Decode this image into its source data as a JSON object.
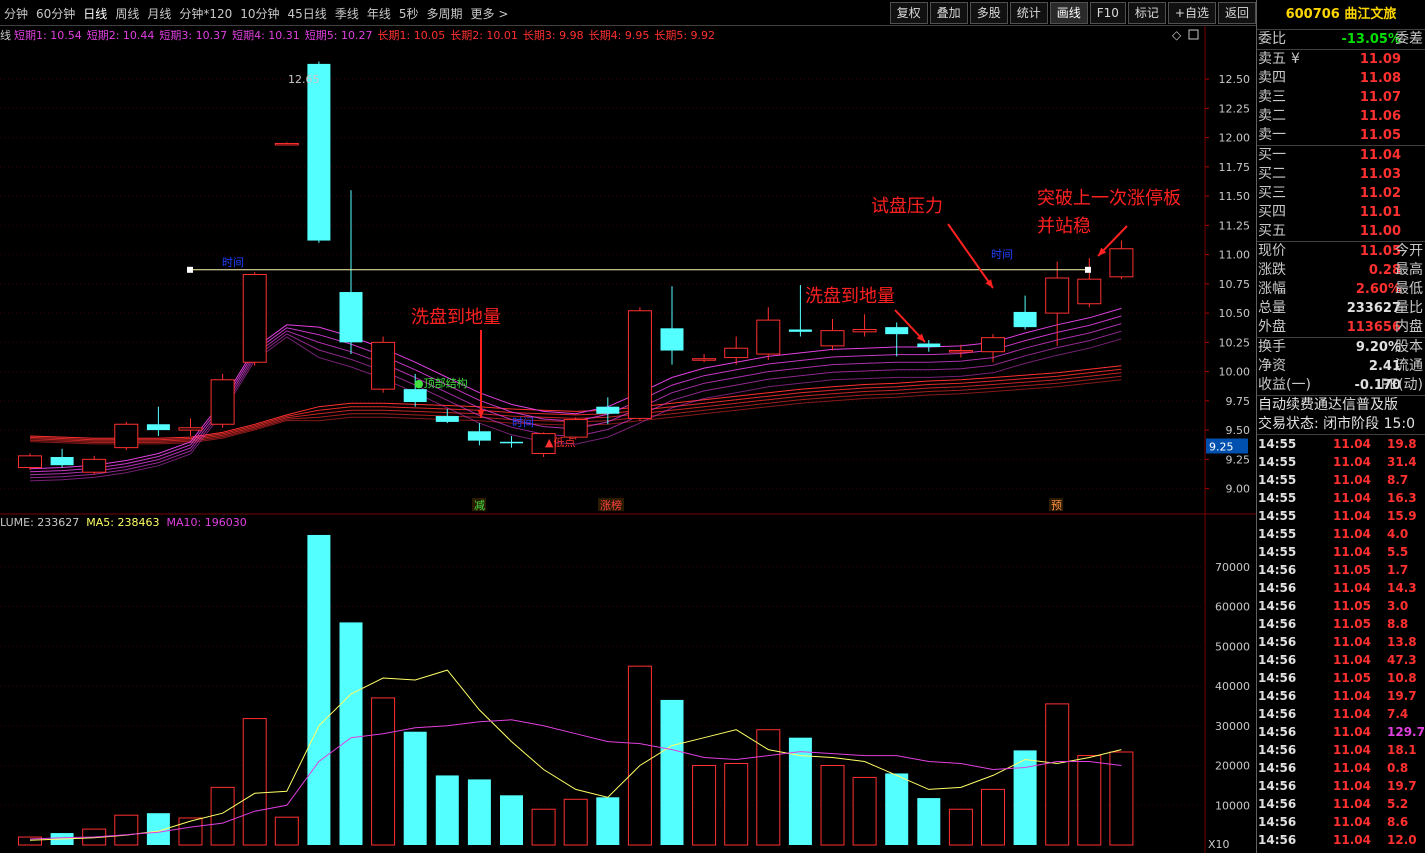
{
  "toolbar": {
    "periods": [
      "分钟",
      "60分钟",
      "日线",
      "周线",
      "月线",
      "分钟*120",
      "10分钟",
      "45日线",
      "季线",
      "年线",
      "5秒",
      "多周期",
      "更多 >"
    ],
    "active_period": "日线",
    "buttons": [
      "复权",
      "叠加",
      "多股",
      "统计",
      "画线",
      "F10",
      "标记",
      "+自选",
      "返回"
    ],
    "active_button": "画线"
  },
  "ma_legend": {
    "prefix": "线",
    "short": [
      "短期1: 10.54",
      "短期2: 10.44",
      "短期3: 10.37",
      "短期4: 10.31",
      "短期5: 10.27"
    ],
    "long": [
      "长期1: 10.05",
      "长期2: 10.01",
      "长期3: 9.98",
      "长期4: 9.95",
      "长期5: 9.92"
    ]
  },
  "volume_legend": {
    "volume": "LUME: 233627",
    "ma5": "MA5: 238463",
    "ma10": "MA10: 196030"
  },
  "annotations": {
    "peak_label": "12.65",
    "marker_time_1": "时间",
    "marker_time_2": "时间",
    "marker_time_3": "时间",
    "top_structure": "●顶部结构",
    "low_point": "▲低点",
    "wash_1": "洗盘到地量",
    "wash_2": "洗盘到地量",
    "test_pressure": "试盘压力",
    "breakout_line1": "突破上一次涨停板",
    "breakout_line2": "并站稳",
    "event_reduce": "减",
    "event_limit_list": "涨榜",
    "event_forecast": "预",
    "current_price_tag": "9.25",
    "volume_scale": "X10"
  },
  "price_axis": [
    "12.50",
    "12.25",
    "12.00",
    "11.75",
    "11.50",
    "11.25",
    "11.00",
    "10.75",
    "10.50",
    "10.25",
    "10.00",
    "9.75",
    "9.50",
    "9.25",
    "9.00"
  ],
  "volume_axis": [
    "70000",
    "60000",
    "50000",
    "40000",
    "30000",
    "20000",
    "10000"
  ],
  "colors": {
    "up": "#ff3030",
    "down": "#54ffff",
    "short_ma": "#e040e0",
    "long_ma": "#ff3030",
    "ma5": "#ffff66",
    "ma10": "#e040e0",
    "annotation": "#ff2020",
    "marker": "#2040ff"
  },
  "chart_data": {
    "type": "candlestick",
    "price_range": [
      8.8,
      12.8
    ],
    "volume_range": [
      0,
      80000
    ],
    "candles": [
      {
        "o": 9.18,
        "c": 9.28,
        "h": 9.3,
        "l": 9.16,
        "v": 2000
      },
      {
        "o": 9.27,
        "c": 9.2,
        "h": 9.34,
        "l": 9.18,
        "v": 3000
      },
      {
        "o": 9.14,
        "c": 9.25,
        "h": 9.28,
        "l": 9.12,
        "v": 4000
      },
      {
        "o": 9.35,
        "c": 9.55,
        "h": 9.57,
        "l": 9.33,
        "v": 7500
      },
      {
        "o": 9.55,
        "c": 9.5,
        "h": 9.7,
        "l": 9.45,
        "v": 8000
      },
      {
        "o": 9.5,
        "c": 9.52,
        "h": 9.6,
        "l": 9.45,
        "v": 6800
      },
      {
        "o": 9.55,
        "c": 9.93,
        "h": 9.98,
        "l": 9.52,
        "v": 14500
      },
      {
        "o": 10.08,
        "c": 10.83,
        "h": 10.85,
        "l": 10.05,
        "v": 31800
      },
      {
        "o": 11.95,
        "c": 11.95,
        "h": 11.96,
        "l": 11.94,
        "v": 7000
      },
      {
        "o": 12.63,
        "c": 11.12,
        "h": 12.65,
        "l": 11.1,
        "v": 78000
      },
      {
        "o": 10.68,
        "c": 10.25,
        "h": 11.55,
        "l": 10.15,
        "v": 56000
      },
      {
        "o": 9.85,
        "c": 10.25,
        "h": 10.3,
        "l": 9.82,
        "v": 37000
      },
      {
        "o": 9.85,
        "c": 9.74,
        "h": 9.98,
        "l": 9.7,
        "v": 28500
      },
      {
        "o": 9.62,
        "c": 9.57,
        "h": 9.68,
        "l": 9.56,
        "v": 17500
      },
      {
        "o": 9.49,
        "c": 9.41,
        "h": 9.56,
        "l": 9.37,
        "v": 16500
      },
      {
        "o": 9.4,
        "c": 9.39,
        "h": 9.45,
        "l": 9.35,
        "v": 12500
      },
      {
        "o": 9.3,
        "c": 9.47,
        "h": 9.48,
        "l": 9.27,
        "v": 9000
      },
      {
        "o": 9.44,
        "c": 9.59,
        "h": 9.61,
        "l": 9.42,
        "v": 11500
      },
      {
        "o": 9.7,
        "c": 9.64,
        "h": 9.78,
        "l": 9.55,
        "v": 12000
      },
      {
        "o": 9.6,
        "c": 10.52,
        "h": 10.55,
        "l": 9.58,
        "v": 45000
      },
      {
        "o": 10.37,
        "c": 10.18,
        "h": 10.73,
        "l": 10.06,
        "v": 36500
      },
      {
        "o": 10.1,
        "c": 10.11,
        "h": 10.15,
        "l": 10.08,
        "v": 20000
      },
      {
        "o": 10.12,
        "c": 10.2,
        "h": 10.3,
        "l": 10.06,
        "v": 20500
      },
      {
        "o": 10.15,
        "c": 10.44,
        "h": 10.55,
        "l": 10.1,
        "v": 29000
      },
      {
        "o": 10.36,
        "c": 10.34,
        "h": 10.74,
        "l": 10.3,
        "v": 27000
      },
      {
        "o": 10.22,
        "c": 10.35,
        "h": 10.45,
        "l": 10.18,
        "v": 20000
      },
      {
        "o": 10.34,
        "c": 10.36,
        "h": 10.49,
        "l": 10.3,
        "v": 17000
      },
      {
        "o": 10.38,
        "c": 10.32,
        "h": 10.42,
        "l": 10.13,
        "v": 18000
      },
      {
        "o": 10.24,
        "c": 10.21,
        "h": 10.27,
        "l": 10.17,
        "v": 11800
      },
      {
        "o": 10.18,
        "c": 10.18,
        "h": 10.23,
        "l": 10.12,
        "v": 9000
      },
      {
        "o": 10.17,
        "c": 10.29,
        "h": 10.32,
        "l": 10.08,
        "v": 14000
      },
      {
        "o": 10.51,
        "c": 10.38,
        "h": 10.65,
        "l": 10.36,
        "v": 23800
      },
      {
        "o": 10.5,
        "c": 10.8,
        "h": 10.94,
        "l": 10.22,
        "v": 35500
      },
      {
        "o": 10.58,
        "c": 10.79,
        "h": 10.97,
        "l": 10.55,
        "v": 22500
      },
      {
        "o": 10.81,
        "c": 11.05,
        "h": 11.12,
        "l": 10.79,
        "v": 23400
      }
    ],
    "ma5_volume": [
      1200,
      1500,
      1800,
      2500,
      3500,
      6000,
      8000,
      13000,
      13500,
      30000,
      38000,
      42000,
      41500,
      44000,
      34000,
      26000,
      19000,
      14000,
      12000,
      20000,
      25000,
      27000,
      29000,
      24000,
      22500,
      22000,
      21000,
      17500,
      14000,
      14500,
      17500,
      21500,
      20500,
      22000,
      24000
    ],
    "ma10_volume": [
      1500,
      1800,
      2000,
      2600,
      3200,
      4500,
      5500,
      8500,
      10000,
      21000,
      27000,
      28000,
      29500,
      30000,
      31000,
      31500,
      30000,
      28000,
      26000,
      25500,
      24000,
      22000,
      21500,
      22500,
      23500,
      23000,
      22500,
      22500,
      21000,
      20500,
      19000,
      19500,
      21000,
      21000,
      20000
    ],
    "short_ma": [
      9.17,
      9.18,
      9.2,
      9.24,
      9.3,
      9.4,
      9.75,
      10.2,
      10.4,
      10.38,
      10.3,
      10.2,
      10.08,
      9.95,
      9.82,
      9.72,
      9.66,
      9.64,
      9.7,
      9.82,
      9.95,
      10.03,
      10.08,
      10.13,
      10.16,
      10.19,
      10.2,
      10.21,
      10.21,
      10.22,
      10.25,
      10.33,
      10.4,
      10.46,
      10.54
    ],
    "long_ma": [
      9.45,
      9.44,
      9.43,
      9.43,
      9.43,
      9.44,
      9.48,
      9.55,
      9.63,
      9.7,
      9.73,
      9.73,
      9.72,
      9.71,
      9.7,
      9.68,
      9.67,
      9.66,
      9.67,
      9.7,
      9.73,
      9.76,
      9.79,
      9.82,
      9.85,
      9.87,
      9.89,
      9.9,
      9.92,
      9.93,
      9.95,
      9.97,
      9.99,
      10.02,
      10.05
    ]
  },
  "quote": {
    "code": "600706",
    "name": "曲江文旅",
    "weibi_label": "委比",
    "weibi_value": "-13.05%",
    "weicha_label": "委差",
    "asks": [
      {
        "label": "卖五",
        "mark": "¥",
        "price": "11.09"
      },
      {
        "label": "卖四",
        "mark": "",
        "price": "11.08"
      },
      {
        "label": "卖三",
        "mark": "",
        "price": "11.07"
      },
      {
        "label": "卖二",
        "mark": "",
        "price": "11.06"
      },
      {
        "label": "卖一",
        "mark": "",
        "price": "11.05"
      }
    ],
    "bids": [
      {
        "label": "买一",
        "price": "11.04"
      },
      {
        "label": "买二",
        "price": "11.03"
      },
      {
        "label": "买三",
        "price": "11.02"
      },
      {
        "label": "买四",
        "price": "11.01"
      },
      {
        "label": "买五",
        "price": "11.00"
      }
    ],
    "stats": [
      {
        "label": "现价",
        "value": "11.05",
        "right": "今开",
        "color": "red"
      },
      {
        "label": "涨跌",
        "value": "0.28",
        "right": "最高",
        "color": "red"
      },
      {
        "label": "涨幅",
        "value": "2.60%",
        "right": "最低",
        "color": "red"
      },
      {
        "label": "总量",
        "value": "233627",
        "right": "量比",
        "color": "white"
      },
      {
        "label": "外盘",
        "value": "113656",
        "right": "内盘",
        "color": "red"
      }
    ],
    "stats2": [
      {
        "label": "换手",
        "value": "9.20%",
        "right": "股本",
        "color": "white"
      },
      {
        "label": "净资",
        "value": "2.41",
        "right": "流通",
        "color": "white"
      },
      {
        "label": "收益(一)",
        "value": "-0.170",
        "right": "PE(动)",
        "color": "white"
      }
    ],
    "info_line1": "自动续费通达信普及版",
    "info_line2": "交易状态: 闭市阶段 15:0",
    "ticks": [
      {
        "time": "14:55",
        "price": "11.04",
        "vol": "19.8",
        "pc": "red",
        "vc": "red"
      },
      {
        "time": "14:55",
        "price": "11.04",
        "vol": "31.4",
        "pc": "red",
        "vc": "red"
      },
      {
        "time": "14:55",
        "price": "11.04",
        "vol": "8.7",
        "pc": "red",
        "vc": "red"
      },
      {
        "time": "14:55",
        "price": "11.04",
        "vol": "16.3",
        "pc": "red",
        "vc": "red"
      },
      {
        "time": "14:55",
        "price": "11.04",
        "vol": "15.9",
        "pc": "red",
        "vc": "red"
      },
      {
        "time": "14:55",
        "price": "11.04",
        "vol": "4.0",
        "pc": "red",
        "vc": "red"
      },
      {
        "time": "14:55",
        "price": "11.04",
        "vol": "5.5",
        "pc": "red",
        "vc": "red"
      },
      {
        "time": "14:56",
        "price": "11.05",
        "vol": "1.7",
        "pc": "red",
        "vc": "red"
      },
      {
        "time": "14:56",
        "price": "11.04",
        "vol": "14.3",
        "pc": "red",
        "vc": "red"
      },
      {
        "time": "14:56",
        "price": "11.05",
        "vol": "3.0",
        "pc": "red",
        "vc": "red"
      },
      {
        "time": "14:56",
        "price": "11.05",
        "vol": "8.8",
        "pc": "red",
        "vc": "red"
      },
      {
        "time": "14:56",
        "price": "11.04",
        "vol": "13.8",
        "pc": "red",
        "vc": "red"
      },
      {
        "time": "14:56",
        "price": "11.04",
        "vol": "47.3",
        "pc": "red",
        "vc": "red"
      },
      {
        "time": "14:56",
        "price": "11.05",
        "vol": "10.8",
        "pc": "red",
        "vc": "red"
      },
      {
        "time": "14:56",
        "price": "11.04",
        "vol": "19.7",
        "pc": "red",
        "vc": "red"
      },
      {
        "time": "14:56",
        "price": "11.04",
        "vol": "7.4",
        "pc": "red",
        "vc": "red"
      },
      {
        "time": "14:56",
        "price": "11.04",
        "vol": "129.7",
        "pc": "red",
        "vc": "magenta"
      },
      {
        "time": "14:56",
        "price": "11.04",
        "vol": "18.1",
        "pc": "red",
        "vc": "red"
      },
      {
        "time": "14:56",
        "price": "11.04",
        "vol": "0.8",
        "pc": "red",
        "vc": "red"
      },
      {
        "time": "14:56",
        "price": "11.04",
        "vol": "19.7",
        "pc": "red",
        "vc": "red"
      },
      {
        "time": "14:56",
        "price": "11.04",
        "vol": "5.2",
        "pc": "red",
        "vc": "red"
      },
      {
        "time": "14:56",
        "price": "11.04",
        "vol": "8.6",
        "pc": "red",
        "vc": "red"
      },
      {
        "time": "14:56",
        "price": "11.04",
        "vol": "12.0",
        "pc": "red",
        "vc": "red"
      }
    ]
  }
}
